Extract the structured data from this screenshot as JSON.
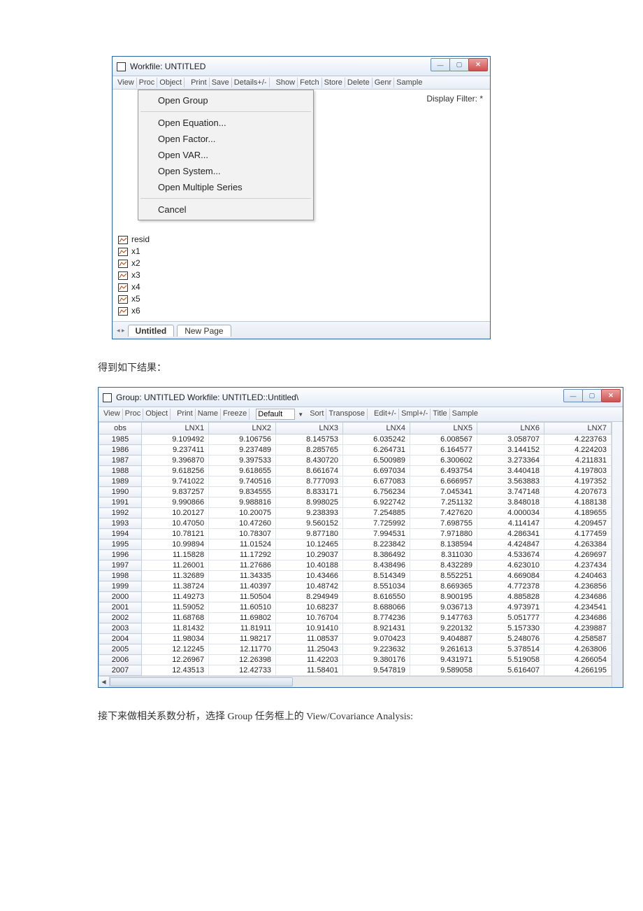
{
  "body_text_1": "得到如下结果：",
  "body_text_2": "接下来做相关系数分析，选择 Group 任务框上的 View/Covariance Analysis:",
  "win1": {
    "title": "Workfile: UNTITLED",
    "toolbar_left": [
      "View",
      "Proc",
      "Object"
    ],
    "toolbar_mid": [
      "Print",
      "Save",
      "Details+/-"
    ],
    "toolbar_right": [
      "Show",
      "Fetch",
      "Store",
      "Delete",
      "Genr",
      "Sample"
    ],
    "display_filter": "Display Filter: *",
    "ctx_menu": [
      "Open Group",
      "Open Equation...",
      "Open Factor...",
      "Open VAR...",
      "Open System...",
      "Open Multiple Series"
    ],
    "ctx_cancel": "Cancel",
    "objects": [
      "resid",
      "x1",
      "x2",
      "x3",
      "x4",
      "x5",
      "x6"
    ],
    "tab_active": "Untitled",
    "tab_new": "New Page"
  },
  "win2": {
    "title": "Group: UNTITLED   Workfile: UNTITLED::Untitled\\",
    "toolbar_a": [
      "View",
      "Proc",
      "Object"
    ],
    "toolbar_b": [
      "Print",
      "Name",
      "Freeze"
    ],
    "default_label": "Default",
    "toolbar_c": [
      "Sort",
      "Transpose"
    ],
    "toolbar_d": [
      "Edit+/-",
      "Smpl+/-",
      "Title",
      "Sample"
    ],
    "columns": [
      "obs",
      "LNX1",
      "LNX2",
      "LNX3",
      "LNX4",
      "LNX5",
      "LNX6",
      "LNX7"
    ],
    "rows": [
      [
        "1985",
        "9.109492",
        "9.106756",
        "8.145753",
        "6.035242",
        "6.008567",
        "3.058707",
        "4.223763"
      ],
      [
        "1986",
        "9.237411",
        "9.237489",
        "8.285765",
        "6.264731",
        "6.164577",
        "3.144152",
        "4.224203"
      ],
      [
        "1987",
        "9.396870",
        "9.397533",
        "8.430720",
        "6.500989",
        "6.300602",
        "3.273364",
        "4.211831"
      ],
      [
        "1988",
        "9.618256",
        "9.618655",
        "8.661674",
        "6.697034",
        "6.493754",
        "3.440418",
        "4.197803"
      ],
      [
        "1989",
        "9.741022",
        "9.740516",
        "8.777093",
        "6.677083",
        "6.666957",
        "3.563883",
        "4.197352"
      ],
      [
        "1990",
        "9.837257",
        "9.834555",
        "8.833171",
        "6.756234",
        "7.045341",
        "3.747148",
        "4.207673"
      ],
      [
        "1991",
        "9.990866",
        "9.988816",
        "8.998025",
        "6.922742",
        "7.251132",
        "3.848018",
        "4.188138"
      ],
      [
        "1992",
        "10.20127",
        "10.20075",
        "9.238393",
        "7.254885",
        "7.427620",
        "4.000034",
        "4.189655"
      ],
      [
        "1993",
        "10.47050",
        "10.47260",
        "9.560152",
        "7.725992",
        "7.698755",
        "4.114147",
        "4.209457"
      ],
      [
        "1994",
        "10.78121",
        "10.78307",
        "9.877180",
        "7.994531",
        "7.971880",
        "4.286341",
        "4.177459"
      ],
      [
        "1995",
        "10.99894",
        "11.01524",
        "10.12465",
        "8.223842",
        "8.138594",
        "4.424847",
        "4.263384"
      ],
      [
        "1996",
        "11.15828",
        "11.17292",
        "10.29037",
        "8.386492",
        "8.311030",
        "4.533674",
        "4.269697"
      ],
      [
        "1997",
        "11.26001",
        "11.27686",
        "10.40188",
        "8.438496",
        "8.432289",
        "4.623010",
        "4.237434"
      ],
      [
        "1998",
        "11.32689",
        "11.34335",
        "10.43466",
        "8.514349",
        "8.552251",
        "4.669084",
        "4.240463"
      ],
      [
        "1999",
        "11.38724",
        "11.40397",
        "10.48742",
        "8.551034",
        "8.669365",
        "4.772378",
        "4.236856"
      ],
      [
        "2000",
        "11.49273",
        "11.50504",
        "8.294949",
        "8.616550",
        "8.900195",
        "4.885828",
        "4.234686"
      ],
      [
        "2001",
        "11.59052",
        "11.60510",
        "10.68237",
        "8.688066",
        "9.036713",
        "4.973971",
        "4.234541"
      ],
      [
        "2002",
        "11.68768",
        "11.69802",
        "10.76704",
        "8.774236",
        "9.147763",
        "5.051777",
        "4.234686"
      ],
      [
        "2003",
        "11.81432",
        "11.81911",
        "10.91410",
        "8.921431",
        "9.220132",
        "5.157330",
        "4.239887"
      ],
      [
        "2004",
        "11.98034",
        "11.98217",
        "11.08537",
        "9.070423",
        "9.404887",
        "5.248076",
        "4.258587"
      ],
      [
        "2005",
        "12.12245",
        "12.11770",
        "11.25043",
        "9.223632",
        "9.261613",
        "5.378514",
        "4.263806"
      ],
      [
        "2006",
        "12.26967",
        "12.26398",
        "11.42203",
        "9.380176",
        "9.431971",
        "5.519058",
        "4.266054"
      ],
      [
        "2007",
        "12.43513",
        "12.42733",
        "11.58401",
        "9.547819",
        "9.589058",
        "5.616407",
        "4.266195"
      ]
    ]
  }
}
